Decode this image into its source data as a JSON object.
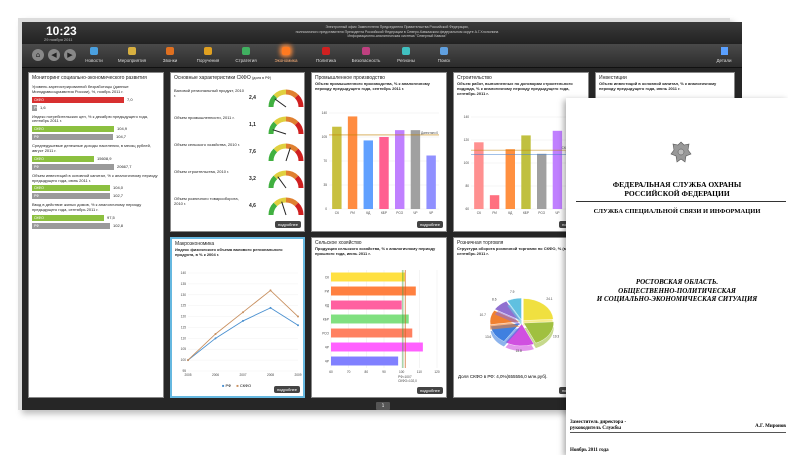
{
  "header": {
    "time": "10:23",
    "date": "29 ноября 2011",
    "headline_lines": [
      "Электронный офис Заместителя Председателя Правительства Российской Федерации,",
      "полномочного представителя Президента Российской Федерации в Северо-Кавказском федеральном округе А.Г.Хлопонина",
      "Информационно-аналитическая система \"Северный Кавказ\""
    ]
  },
  "nav": {
    "items": [
      {
        "label": "Новости",
        "color": "#4aa0e0"
      },
      {
        "label": "Мероприятия",
        "color": "#d8b040"
      },
      {
        "label": "Звонки",
        "color": "#e07020"
      },
      {
        "label": "Поручения",
        "color": "#e0a020"
      },
      {
        "label": "Стратегия",
        "color": "#40b060"
      },
      {
        "label": "Экономика",
        "color": "#ff7a20"
      },
      {
        "label": "Политика",
        "color": "#d02020"
      },
      {
        "label": "Безопасность",
        "color": "#c04080"
      },
      {
        "label": "Регионы",
        "color": "#40c0c0"
      },
      {
        "label": "Поиск",
        "color": "#60a0e0"
      }
    ],
    "active_index": 5,
    "details_label": "Детали"
  },
  "monitoring": {
    "title": "Мониторинг социально-экономического развития",
    "items": [
      {
        "label": "Уровень зарегистрированной безработицы (данные Минздравсоцразвития России), %, ноябрь 2011 г.",
        "rows": [
          {
            "tag": "СКФО",
            "value": "7,0",
            "frac": 0.92,
            "color": "#d83030"
          },
          {
            "tag": "РФ",
            "value": "1,6",
            "frac": 0.05,
            "color": "#9a9a9a"
          }
        ]
      },
      {
        "label": "Индекс потребительских цен, % к декабрю предыдущего года, сентябрь 2011 г.",
        "rows": [
          {
            "tag": "СКФО",
            "value": "104,9",
            "frac": 0.82,
            "color": "#8cc040"
          },
          {
            "tag": "РФ",
            "value": "104,7",
            "frac": 0.81,
            "color": "#9a9a9a"
          }
        ]
      },
      {
        "label": "Среднедушевые денежные доходы населения, в месяц рублей, август 2011 г.",
        "rows": [
          {
            "tag": "СКФО",
            "value": "15608,9",
            "frac": 0.62,
            "color": "#8cc040"
          },
          {
            "tag": "РФ",
            "value": "20667,7",
            "frac": 0.82,
            "color": "#9a9a9a"
          }
        ]
      },
      {
        "label": "Объем инвестиций в основной капитал, % к аналогичному периоду предыдущего года, июнь 2011 г.",
        "rows": [
          {
            "tag": "СКФО",
            "value": "104,0",
            "frac": 0.78,
            "color": "#8cc040"
          },
          {
            "tag": "РФ",
            "value": "102,7",
            "frac": 0.78,
            "color": "#9a9a9a"
          }
        ]
      },
      {
        "label": "Ввод в действие жилых домов, % к аналогичному периоду предыдущего года, сентябрь 2011 г.",
        "rows": [
          {
            "tag": "СКФО",
            "value": "97,5",
            "frac": 0.72,
            "color": "#8cc040"
          },
          {
            "tag": "РФ",
            "value": "102,8",
            "frac": 0.78,
            "color": "#9a9a9a"
          }
        ]
      }
    ]
  },
  "basic": {
    "title": "Основные характеристики СКФО",
    "title_unit": "(доля в РФ)",
    "items": [
      {
        "label": "Валовой региональный продукт, 2010 г.",
        "value": "2,4",
        "level": 0.2
      },
      {
        "label": "Объем промышленности, 2011 г.",
        "value": "1,1",
        "level": 0.1
      },
      {
        "label": "Объем сельского хозяйства, 2010 г.",
        "value": "7,6",
        "level": 0.6
      },
      {
        "label": "Объем строительства, 2010 г.",
        "value": "3,2",
        "level": 0.3
      },
      {
        "label": "Объем розничного товарооборота, 2010 г.",
        "value": "4,6",
        "level": 0.4
      }
    ]
  },
  "industry": {
    "title": "Промышленное производство",
    "subtitle": "Объем промышленного производства, % к аналогичному периоду предыдущего года, сентябрь 2011 г.",
    "ref_label": "Дагестан=0"
  },
  "construction": {
    "title": "Строительство",
    "subtitle": "Объем работ, выполненных по договорам строительного подряда, % к аналогичному периоду предыдущего года, сентябрь 2011 г.",
    "ref1": "СКФО=111,2",
    "ref2": "РФ=107,5"
  },
  "investment": {
    "title": "Инвестиции",
    "subtitle": "Объем инвестиций в основной капитал, % к аналогичному периоду предыдущего года, июнь 2011 г."
  },
  "macro": {
    "title": "Макроэкономика",
    "subtitle": "Индекс физического объема валового регионального продукта, в % к 2004 г.",
    "legend": [
      "РФ",
      "СКФО"
    ]
  },
  "agri": {
    "title": "Сельское хозяйство",
    "subtitle": "Продукция сельского хозяйства, % к аналогичному периоду прошлого года, июнь 2011 г.",
    "ref1": "РФ=1007",
    "ref2": "СКФО=102,0"
  },
  "retail": {
    "title": "Розничная торговля",
    "subtitle": "Структура оборота розничной торговли по СКФО, % (млн.руб.), сентябрь 2011 г.",
    "note": "Доля СКФО в РФ: 4,0%(655556,0 млн.руб)."
  },
  "more_label": "подробнее",
  "pager": "1",
  "chart_data": [
    {
      "type": "bar",
      "title": "Промышленное производство",
      "categories": [
        "СК",
        "РИ",
        "КД",
        "КБР",
        "РСО",
        "ЧР",
        "ЧР"
      ],
      "values": [
        120,
        135,
        100,
        105,
        115,
        115,
        78
      ],
      "colors": [
        "#c8c040",
        "#ff8c40",
        "#60a0ff",
        "#ff6090",
        "#c080ff",
        "#a0a0a0",
        "#9090ff"
      ],
      "ylim": [
        0,
        140
      ],
      "ref": 108
    },
    {
      "type": "bar",
      "title": "Строительство",
      "categories": [
        "СК",
        "РИ",
        "КД",
        "КБР",
        "РСО",
        "ЧР",
        "ЧР"
      ],
      "values": [
        118,
        72,
        112,
        124,
        108,
        128,
        90
      ],
      "colors": [
        "#ff9090",
        "#ff7080",
        "#ff9040",
        "#c0c040",
        "#a0a0a0",
        "#c080ff",
        "#ff60a0"
      ],
      "ylim": [
        60,
        140
      ],
      "refs": [
        111.2,
        107.5
      ]
    },
    {
      "type": "bar",
      "title": "Сельское хозяйство",
      "categories": [
        "СК",
        "РИ",
        "КД",
        "КБР",
        "РСО",
        "ЧР",
        "ЧР"
      ],
      "values": [
        102,
        108,
        100,
        104,
        106,
        112,
        98
      ],
      "colors": [
        "#ffe040",
        "#ff8040",
        "#ff60a0",
        "#80e080",
        "#ff8060",
        "#ff60ff",
        "#8080ff"
      ],
      "xlim": [
        60,
        120
      ]
    },
    {
      "type": "line",
      "title": "Макроэкономика",
      "x": [
        2005,
        2006,
        2007,
        2008,
        2009
      ],
      "series": [
        {
          "name": "РФ",
          "values": [
            100,
            110,
            118,
            124,
            116
          ],
          "color": "#4a90d0"
        },
        {
          "name": "СКФО",
          "values": [
            100,
            112,
            122,
            132,
            120
          ],
          "color": "#c89060"
        }
      ],
      "ylim": [
        95,
        140
      ]
    },
    {
      "type": "pie",
      "title": "Розничная торговля",
      "values": [
        24.1,
        19.3,
        15.8,
        13.6,
        10.7,
        8.6,
        7.9
      ],
      "colors": [
        "#f0e040",
        "#a0c040",
        "#d050e0",
        "#4080e0",
        "#f08030",
        "#9070d0",
        "#60c0e0"
      ]
    }
  ],
  "document": {
    "org": "ФЕДЕРАЛЬНАЯ СЛУЖБА ОХРАНЫ\nРОССИЙСКОЙ ФЕДЕРАЦИИ",
    "service": "СЛУЖБА СПЕЦИАЛЬНОЙ СВЯЗИ И ИНФОРМАЦИИ",
    "title": "РОСТОВСКАЯ ОБЛАСТЬ.\nОБЩЕСТВЕННО-ПОЛИТИЧЕСКАЯ\nИ СОЦИАЛЬНО-ЭКОНОМИЧЕСКАЯ СИТУАЦИЯ",
    "signer_title": "Заместитель директора -\nруководитель Службы",
    "signer_name": "А.Г. Миронов",
    "date": "Ноябрь 2011 года"
  }
}
